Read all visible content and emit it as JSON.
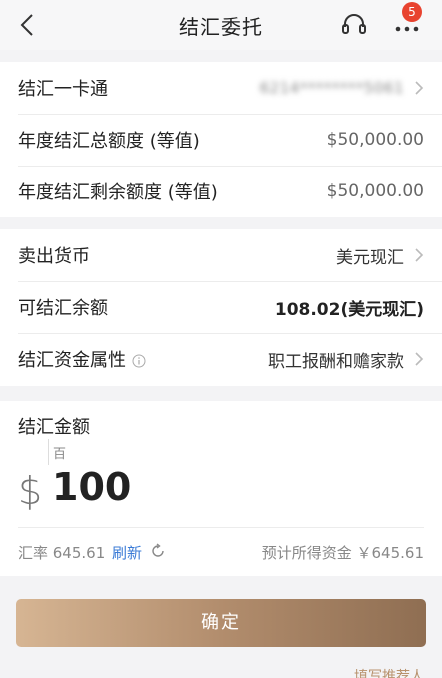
{
  "header": {
    "title": "结汇委托",
    "badge_count": "5",
    "icons": [
      "back-arrow-icon",
      "headset-icon",
      "more-icon"
    ]
  },
  "account_section": {
    "rows": [
      {
        "label": "结汇一卡通",
        "value": "6214********5061"
      },
      {
        "label": "年度结汇总额度 (等值)",
        "value": "$50,000.00"
      },
      {
        "label": "年度结汇剩余额度 (等值)",
        "value": "$50,000.00"
      }
    ]
  },
  "currency_section": {
    "sell_currency": {
      "label": "卖出货币",
      "value": "美元现汇"
    },
    "available": {
      "label": "可结汇余额",
      "value": "108.02(美元现汇)"
    },
    "fund_attribute": {
      "label": "结汇资金属性",
      "value": "职工报酬和赡家款"
    }
  },
  "amount": {
    "title": "结汇金额",
    "unit_hint": "百",
    "currency_symbol": "$",
    "value": "100",
    "rate_text": "汇率 645.61",
    "refresh_label": "刷新",
    "estimate_text": "预计所得资金 ￥645.61"
  },
  "confirm_label": "确定",
  "bottom_hint": "填写推荐人",
  "colors": {
    "accent_blue": "#3b7bd6",
    "badge_red": "#e8432f",
    "button_gradient_start": "#d6b593",
    "button_gradient_end": "#8f6e52"
  }
}
